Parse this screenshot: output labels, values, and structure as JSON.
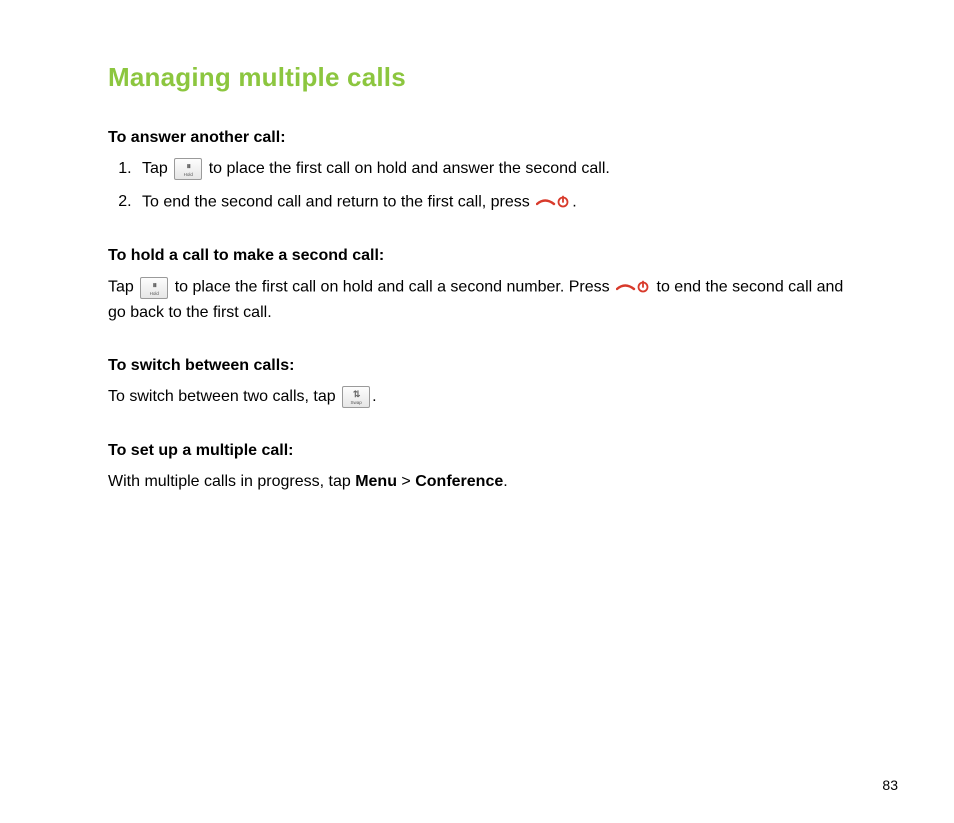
{
  "title": "Managing multiple calls",
  "sections": {
    "answer": {
      "heading": "To answer another call:",
      "step1_a": "Tap ",
      "step1_b": " to place the first call on hold and answer the second call.",
      "step2_a": "To end the second call and return to the first call,  press ",
      "step2_b": "."
    },
    "hold": {
      "heading": "To hold a call to make a second call:",
      "text_a": "Tap ",
      "text_b": " to place the first call on hold and call a second number. Press ",
      "text_c": " to end the second call and go back to the first call."
    },
    "switch": {
      "heading": "To switch between calls:",
      "text_a": "To switch between two calls, tap ",
      "text_b": "."
    },
    "multiple": {
      "heading": "To set up a multiple call:",
      "text_a": "With multiple calls in progress, tap ",
      "menu": "Menu",
      "gt": " > ",
      "conference": "Conference",
      "text_b": "."
    }
  },
  "icons": {
    "hold_label": "Hold",
    "swap_label": "Swap"
  },
  "page_number": "83"
}
